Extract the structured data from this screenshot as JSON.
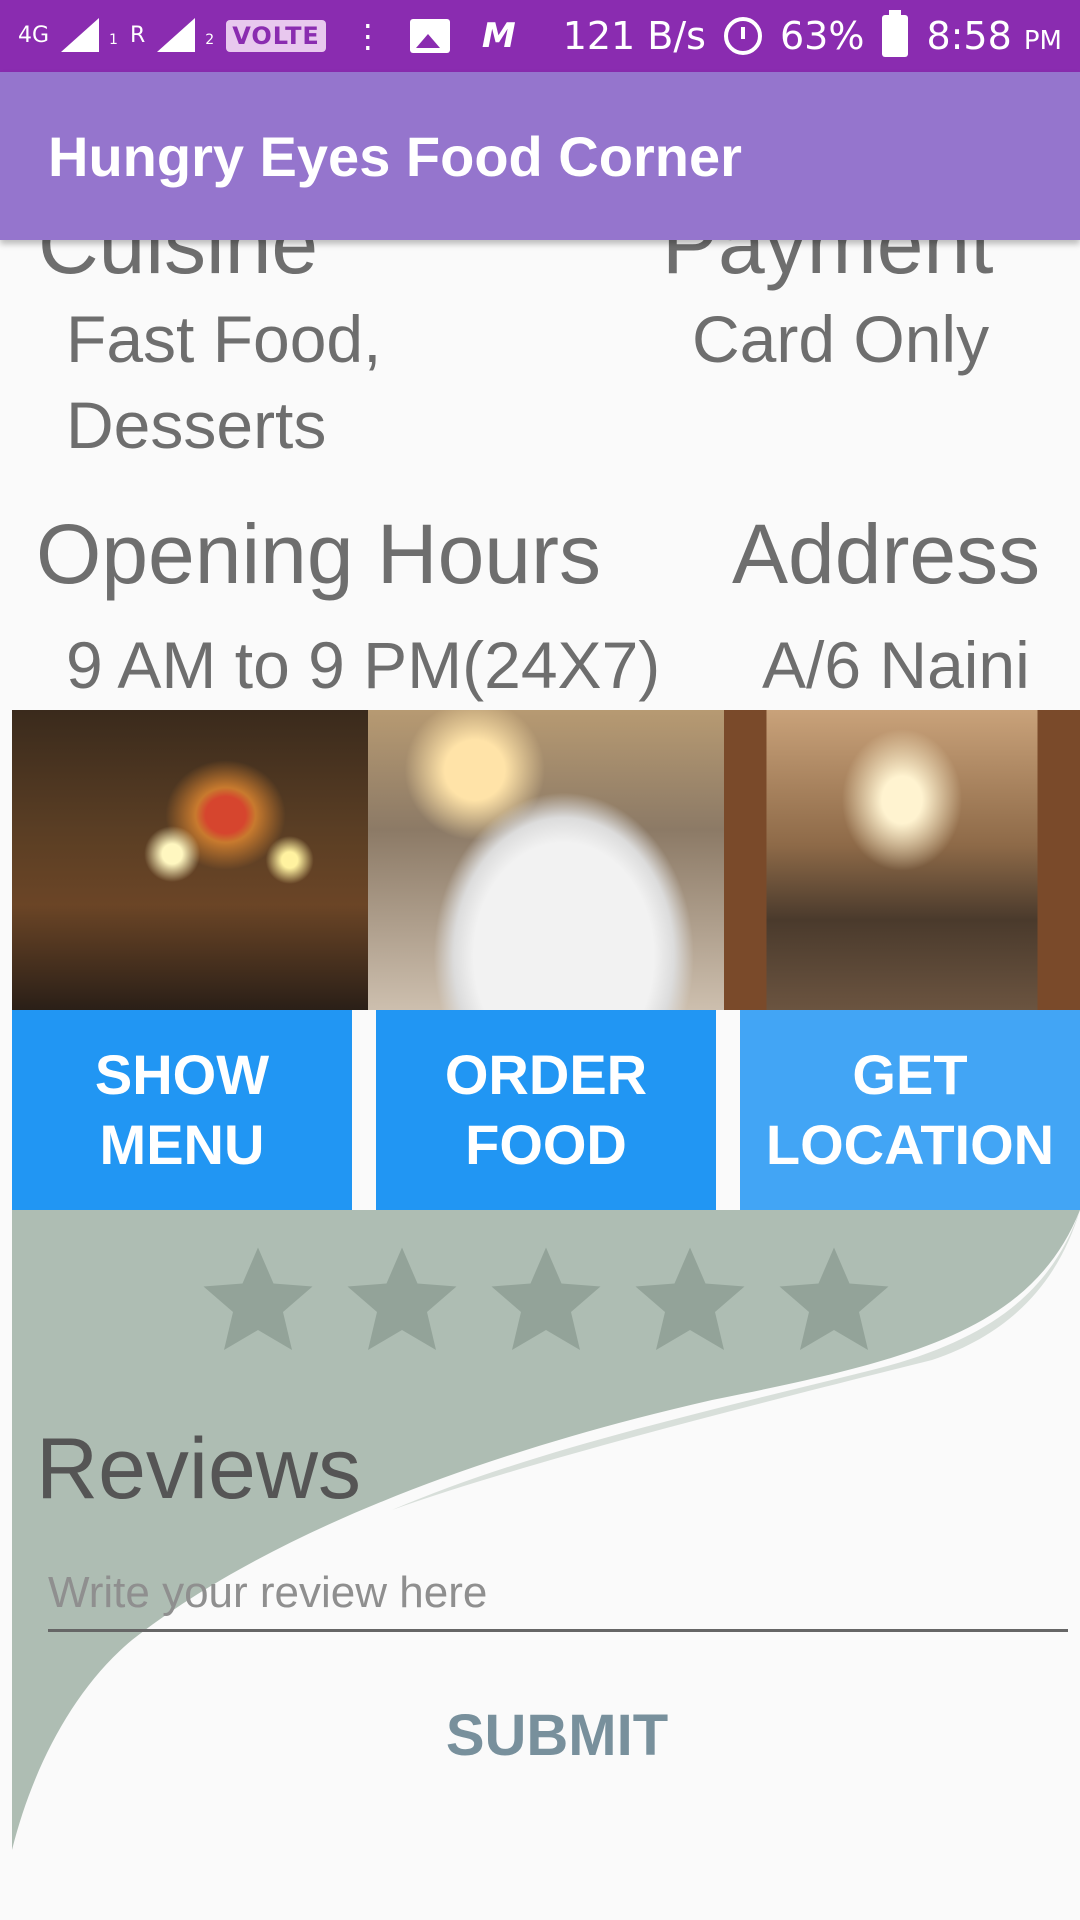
{
  "status_bar": {
    "network": "4G",
    "sim1_sub": "1",
    "roaming": "R",
    "sim2_sub": "2",
    "volte": "VOLTE",
    "speed": "121 B/s",
    "battery": "63%",
    "time": "8:58",
    "ampm": "PM"
  },
  "app_bar": {
    "title": "Hungry Eyes Food Corner"
  },
  "info": {
    "cuisine_heading": "Cuisine",
    "cuisine_value_line1": "Fast Food,",
    "cuisine_value_line2": "Desserts",
    "payment_heading": "Payment",
    "payment_value": "Card Only",
    "hours_heading": "Opening Hours",
    "hours_value": "9 AM to 9 PM(24X7)",
    "address_heading": "Address",
    "address_value": "A/6 Naini"
  },
  "actions": {
    "show_menu_line1": "SHOW",
    "show_menu_line2": "MENU",
    "order_food_line1": "ORDER",
    "order_food_line2": "FOOD",
    "get_location_line1": "GET",
    "get_location_line2": "LOCATION"
  },
  "rating": {
    "max_stars": 5,
    "value": 0
  },
  "reviews": {
    "title": "Reviews",
    "placeholder": "Write your review here",
    "value": "",
    "submit_label": "SUBMIT"
  },
  "colors": {
    "status_bar": "#8a2cb0",
    "app_bar": "#9575cd",
    "button_blue": "#2196f3",
    "button_light_blue": "#42a5f5",
    "submit_text": "#78909c"
  }
}
